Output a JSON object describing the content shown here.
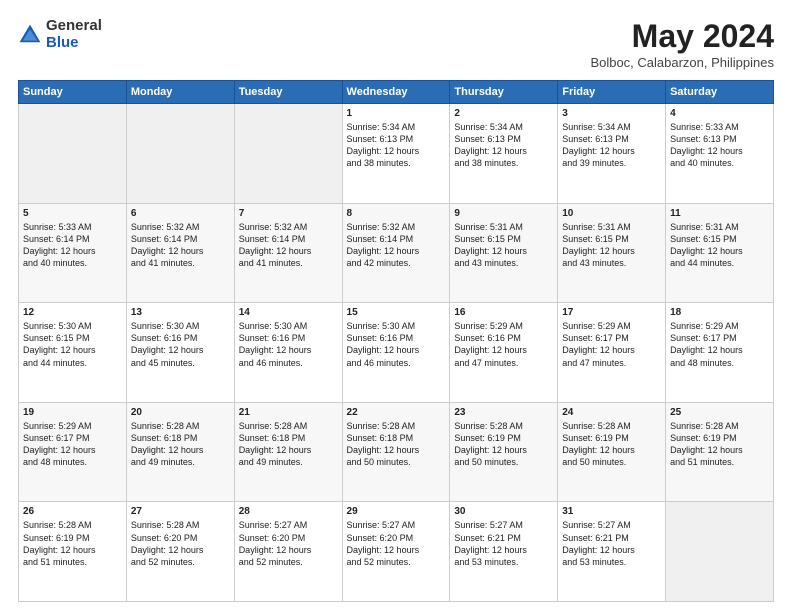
{
  "logo": {
    "general": "General",
    "blue": "Blue"
  },
  "title": "May 2024",
  "subtitle": "Bolboc, Calabarzon, Philippines",
  "days_header": [
    "Sunday",
    "Monday",
    "Tuesday",
    "Wednesday",
    "Thursday",
    "Friday",
    "Saturday"
  ],
  "weeks": [
    {
      "row_bg": "#fff",
      "days": [
        {
          "num": "",
          "info": ""
        },
        {
          "num": "",
          "info": ""
        },
        {
          "num": "",
          "info": ""
        },
        {
          "num": "1",
          "info": "Sunrise: 5:34 AM\nSunset: 6:13 PM\nDaylight: 12 hours\nand 38 minutes."
        },
        {
          "num": "2",
          "info": "Sunrise: 5:34 AM\nSunset: 6:13 PM\nDaylight: 12 hours\nand 38 minutes."
        },
        {
          "num": "3",
          "info": "Sunrise: 5:34 AM\nSunset: 6:13 PM\nDaylight: 12 hours\nand 39 minutes."
        },
        {
          "num": "4",
          "info": "Sunrise: 5:33 AM\nSunset: 6:13 PM\nDaylight: 12 hours\nand 40 minutes."
        }
      ]
    },
    {
      "row_bg": "#f7f7f7",
      "days": [
        {
          "num": "5",
          "info": "Sunrise: 5:33 AM\nSunset: 6:14 PM\nDaylight: 12 hours\nand 40 minutes."
        },
        {
          "num": "6",
          "info": "Sunrise: 5:32 AM\nSunset: 6:14 PM\nDaylight: 12 hours\nand 41 minutes."
        },
        {
          "num": "7",
          "info": "Sunrise: 5:32 AM\nSunset: 6:14 PM\nDaylight: 12 hours\nand 41 minutes."
        },
        {
          "num": "8",
          "info": "Sunrise: 5:32 AM\nSunset: 6:14 PM\nDaylight: 12 hours\nand 42 minutes."
        },
        {
          "num": "9",
          "info": "Sunrise: 5:31 AM\nSunset: 6:15 PM\nDaylight: 12 hours\nand 43 minutes."
        },
        {
          "num": "10",
          "info": "Sunrise: 5:31 AM\nSunset: 6:15 PM\nDaylight: 12 hours\nand 43 minutes."
        },
        {
          "num": "11",
          "info": "Sunrise: 5:31 AM\nSunset: 6:15 PM\nDaylight: 12 hours\nand 44 minutes."
        }
      ]
    },
    {
      "row_bg": "#fff",
      "days": [
        {
          "num": "12",
          "info": "Sunrise: 5:30 AM\nSunset: 6:15 PM\nDaylight: 12 hours\nand 44 minutes."
        },
        {
          "num": "13",
          "info": "Sunrise: 5:30 AM\nSunset: 6:16 PM\nDaylight: 12 hours\nand 45 minutes."
        },
        {
          "num": "14",
          "info": "Sunrise: 5:30 AM\nSunset: 6:16 PM\nDaylight: 12 hours\nand 46 minutes."
        },
        {
          "num": "15",
          "info": "Sunrise: 5:30 AM\nSunset: 6:16 PM\nDaylight: 12 hours\nand 46 minutes."
        },
        {
          "num": "16",
          "info": "Sunrise: 5:29 AM\nSunset: 6:16 PM\nDaylight: 12 hours\nand 47 minutes."
        },
        {
          "num": "17",
          "info": "Sunrise: 5:29 AM\nSunset: 6:17 PM\nDaylight: 12 hours\nand 47 minutes."
        },
        {
          "num": "18",
          "info": "Sunrise: 5:29 AM\nSunset: 6:17 PM\nDaylight: 12 hours\nand 48 minutes."
        }
      ]
    },
    {
      "row_bg": "#f7f7f7",
      "days": [
        {
          "num": "19",
          "info": "Sunrise: 5:29 AM\nSunset: 6:17 PM\nDaylight: 12 hours\nand 48 minutes."
        },
        {
          "num": "20",
          "info": "Sunrise: 5:28 AM\nSunset: 6:18 PM\nDaylight: 12 hours\nand 49 minutes."
        },
        {
          "num": "21",
          "info": "Sunrise: 5:28 AM\nSunset: 6:18 PM\nDaylight: 12 hours\nand 49 minutes."
        },
        {
          "num": "22",
          "info": "Sunrise: 5:28 AM\nSunset: 6:18 PM\nDaylight: 12 hours\nand 50 minutes."
        },
        {
          "num": "23",
          "info": "Sunrise: 5:28 AM\nSunset: 6:19 PM\nDaylight: 12 hours\nand 50 minutes."
        },
        {
          "num": "24",
          "info": "Sunrise: 5:28 AM\nSunset: 6:19 PM\nDaylight: 12 hours\nand 50 minutes."
        },
        {
          "num": "25",
          "info": "Sunrise: 5:28 AM\nSunset: 6:19 PM\nDaylight: 12 hours\nand 51 minutes."
        }
      ]
    },
    {
      "row_bg": "#fff",
      "days": [
        {
          "num": "26",
          "info": "Sunrise: 5:28 AM\nSunset: 6:19 PM\nDaylight: 12 hours\nand 51 minutes."
        },
        {
          "num": "27",
          "info": "Sunrise: 5:28 AM\nSunset: 6:20 PM\nDaylight: 12 hours\nand 52 minutes."
        },
        {
          "num": "28",
          "info": "Sunrise: 5:27 AM\nSunset: 6:20 PM\nDaylight: 12 hours\nand 52 minutes."
        },
        {
          "num": "29",
          "info": "Sunrise: 5:27 AM\nSunset: 6:20 PM\nDaylight: 12 hours\nand 52 minutes."
        },
        {
          "num": "30",
          "info": "Sunrise: 5:27 AM\nSunset: 6:21 PM\nDaylight: 12 hours\nand 53 minutes."
        },
        {
          "num": "31",
          "info": "Sunrise: 5:27 AM\nSunset: 6:21 PM\nDaylight: 12 hours\nand 53 minutes."
        },
        {
          "num": "",
          "info": ""
        }
      ]
    }
  ]
}
